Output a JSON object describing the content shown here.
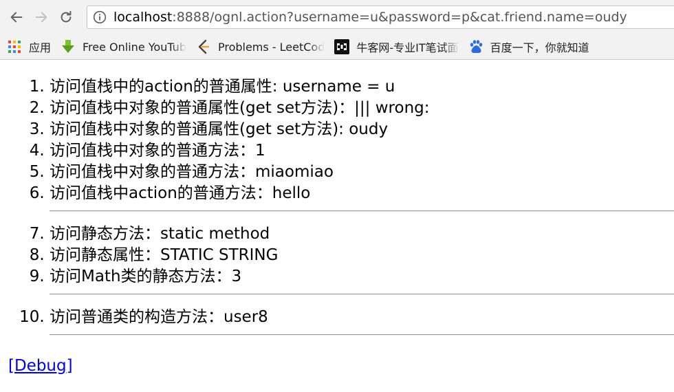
{
  "browser": {
    "url_host": "localhost",
    "url_rest": ":8888/ognl.action?username=u&password=p&cat.friend.name=oudy",
    "bookmarks": [
      {
        "label": "应用",
        "icon": "apps-grid-icon"
      },
      {
        "label": "Free Online YouTub",
        "icon": "download-arrow-icon"
      },
      {
        "label": "Problems - LeetCod",
        "icon": "leetcode-icon"
      },
      {
        "label": "牛客网-专业IT笔试面",
        "icon": "nowcoder-icon"
      },
      {
        "label": "百度一下，你就知道",
        "icon": "baidu-paw-icon"
      }
    ]
  },
  "page": {
    "list1": [
      "访问值栈中的action的普通属性: username = u",
      "访问值栈中对象的普通属性(get set方法)：|||  wrong:",
      "访问值栈中对象的普通属性(get set方法): oudy",
      "访问值栈中对象的普通方法：1",
      "访问值栈中对象的普通方法：miaomiao",
      "访问值栈中action的普通方法：hello"
    ],
    "list2": [
      "访问静态方法：static method",
      "访问静态属性：STATIC STRING",
      "访问Math类的静态方法：3"
    ],
    "list3": [
      "访问普通类的构造方法：user8"
    ],
    "debug_link": "[Debug]"
  }
}
